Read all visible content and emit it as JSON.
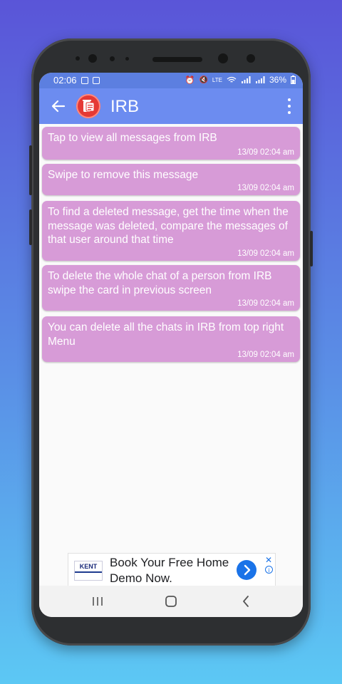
{
  "status_bar": {
    "time": "02:06",
    "battery": "36%",
    "network_label": "LTE"
  },
  "app_bar": {
    "title": "IRB",
    "back_icon": "arrow-left-icon",
    "menu_icon": "more-vert-icon",
    "avatar_color": "#e53935"
  },
  "messages": [
    {
      "text": "Tap to view all messages from IRB",
      "time": "13/09 02:04 am"
    },
    {
      "text": "Swipe to remove this message",
      "time": "13/09 02:04 am"
    },
    {
      "text": "To find a deleted message, get the time when the message was deleted, compare the messages of that user around that time",
      "time": "13/09 02:04 am"
    },
    {
      "text": "To delete the whole chat of a person from IRB swipe the card in previous screen",
      "time": "13/09 02:04 am"
    },
    {
      "text": "You can delete all the chats in IRB from top right Menu",
      "time": "13/09 02:04 am"
    }
  ],
  "ad": {
    "brand": "KENT",
    "headline": "Book Your Free Home Demo Now.",
    "close": "✕",
    "info": "i"
  },
  "colors": {
    "app_bar": "#6c8cf0",
    "card": "#d79bd7",
    "background_top": "#5a55d8",
    "background_bottom": "#5cc8f4"
  }
}
